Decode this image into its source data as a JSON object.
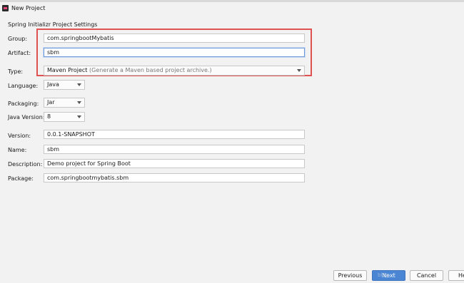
{
  "window": {
    "title": "New Project"
  },
  "section_title": "Spring Initializr Project Settings",
  "form": {
    "group": {
      "label": "Group:",
      "value": "com.springbootMybatis"
    },
    "artifact": {
      "label": "Artifact:",
      "value": "sbm"
    },
    "type": {
      "label": "Type:",
      "value": "Maven Project",
      "hint": "(Generate a Maven based project archive.)"
    },
    "language": {
      "label": "Language:",
      "value": "Java"
    },
    "packaging": {
      "label": "Packaging:",
      "value": "Jar"
    },
    "java_version": {
      "label": "Java Version:",
      "value": "8"
    },
    "version": {
      "label": "Version:",
      "value": "0.0.1-SNAPSHOT"
    },
    "name": {
      "label": "Name:",
      "value": "sbm"
    },
    "description": {
      "label": "Description:",
      "value": "Demo project for Spring Boot"
    },
    "package": {
      "label": "Package:",
      "value": "com.springbootmybatis.sbm"
    }
  },
  "buttons": {
    "previous": "Previous",
    "next": "Next",
    "cancel": "Cancel",
    "help": "He"
  },
  "watermark": "blog",
  "colors": {
    "highlight": "#e05252",
    "accent": "#4a86d4"
  }
}
